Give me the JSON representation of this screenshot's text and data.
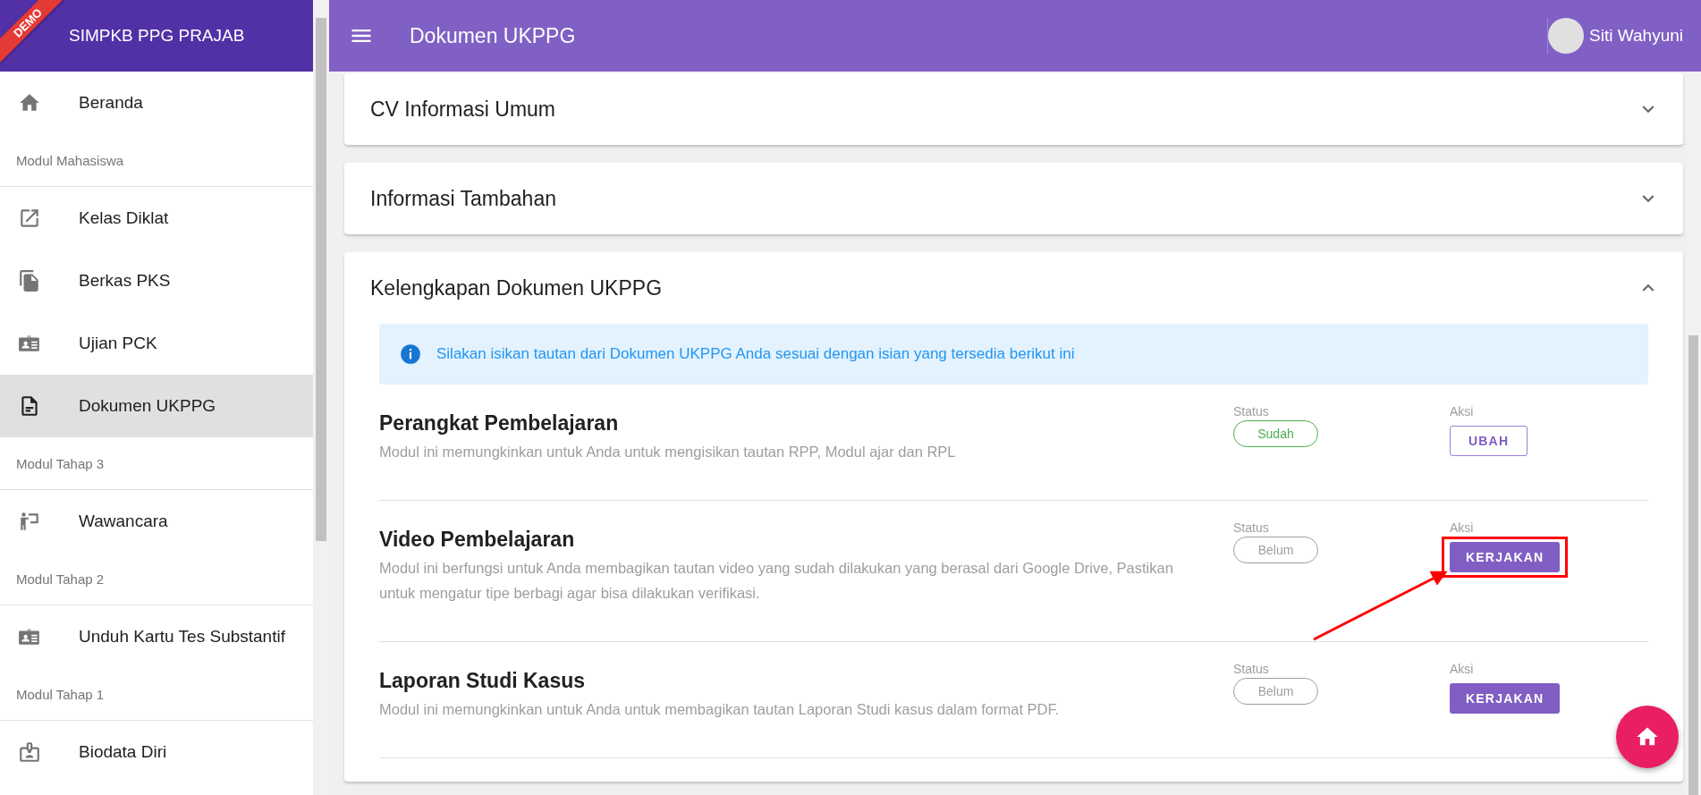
{
  "sidebar": {
    "ribbon": "DEMO",
    "brand": "SIMPKB PPG PRAJAB",
    "items": [
      {
        "kind": "link",
        "label": "Beranda",
        "selected": false
      },
      {
        "kind": "header",
        "label": "Modul Mahasiswa"
      },
      {
        "kind": "link",
        "label": "Kelas Diklat",
        "selected": false
      },
      {
        "kind": "link",
        "label": "Berkas PKS",
        "selected": false
      },
      {
        "kind": "link",
        "label": "Ujian PCK",
        "selected": false
      },
      {
        "kind": "link",
        "label": "Dokumen UKPPG",
        "selected": true
      },
      {
        "kind": "header",
        "label": "Modul Tahap 3"
      },
      {
        "kind": "link",
        "label": "Wawancara",
        "selected": false
      },
      {
        "kind": "header",
        "label": "Modul Tahap 2"
      },
      {
        "kind": "link",
        "label": "Unduh Kartu Tes Substantif",
        "selected": false
      },
      {
        "kind": "header",
        "label": "Modul Tahap 1"
      },
      {
        "kind": "link",
        "label": "Biodata Diri",
        "selected": false
      }
    ]
  },
  "header": {
    "title": "Dokumen UKPPG",
    "user": "Siti Wahyuni"
  },
  "panels": [
    {
      "title": "CV Informasi Umum",
      "expanded": false
    },
    {
      "title": "Informasi Tambahan",
      "expanded": false
    },
    {
      "title": "Kelengkapan Dokumen UKPPG",
      "expanded": true,
      "alert": "Silakan isikan tautan dari Dokumen UKPPG Anda sesuai dengan isian yang tersedia berikut ini",
      "items": [
        {
          "title": "Perangkat Pembelajaran",
          "description": "Modul ini memungkinkan untuk Anda untuk mengisikan tautan RPP, Modul ajar dan RPL",
          "status_label": "Status",
          "status": "Sudah",
          "done": true,
          "action_label": "Aksi",
          "action": "UBAH",
          "highlighted": false
        },
        {
          "title": "Video Pembelajaran",
          "description": "Modul ini berfungsi untuk Anda membagikan tautan video yang sudah dilakukan yang berasal dari Google Drive, Pastikan untuk mengatur tipe berbagi agar bisa dilakukan verifikasi.",
          "status_label": "Status",
          "status": "Belum",
          "done": false,
          "action_label": "Aksi",
          "action": "KERJAKAN",
          "highlighted": true
        },
        {
          "title": "Laporan Studi Kasus",
          "description": "Modul ini memungkinkan untuk Anda untuk membagikan tautan Laporan Studi kasus dalam format PDF.",
          "status_label": "Status",
          "status": "Belum",
          "done": false,
          "action_label": "Aksi",
          "action": "KERJAKAN",
          "highlighted": false
        }
      ]
    }
  ]
}
